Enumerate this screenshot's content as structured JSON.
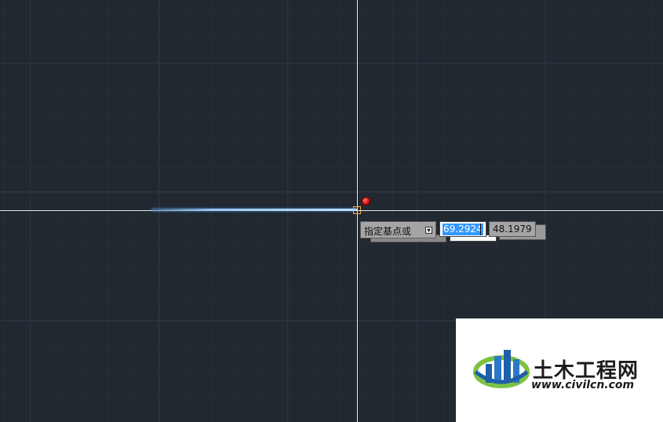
{
  "command_prompt": {
    "text": "指定基点或",
    "options_arrow": "▾"
  },
  "coordinate_input": {
    "x_value": "69.2924",
    "y_value": "48.1979"
  },
  "watermark": {
    "title": "土木工程网",
    "url": "www.civilcn.com"
  },
  "colors": {
    "background": "#212830",
    "crosshair": "#e6e6e6",
    "rubber_line": "#9cc8f0",
    "pick_box": "#ffb040",
    "snap_marker": "#d00000",
    "selection": "#3399ff"
  }
}
